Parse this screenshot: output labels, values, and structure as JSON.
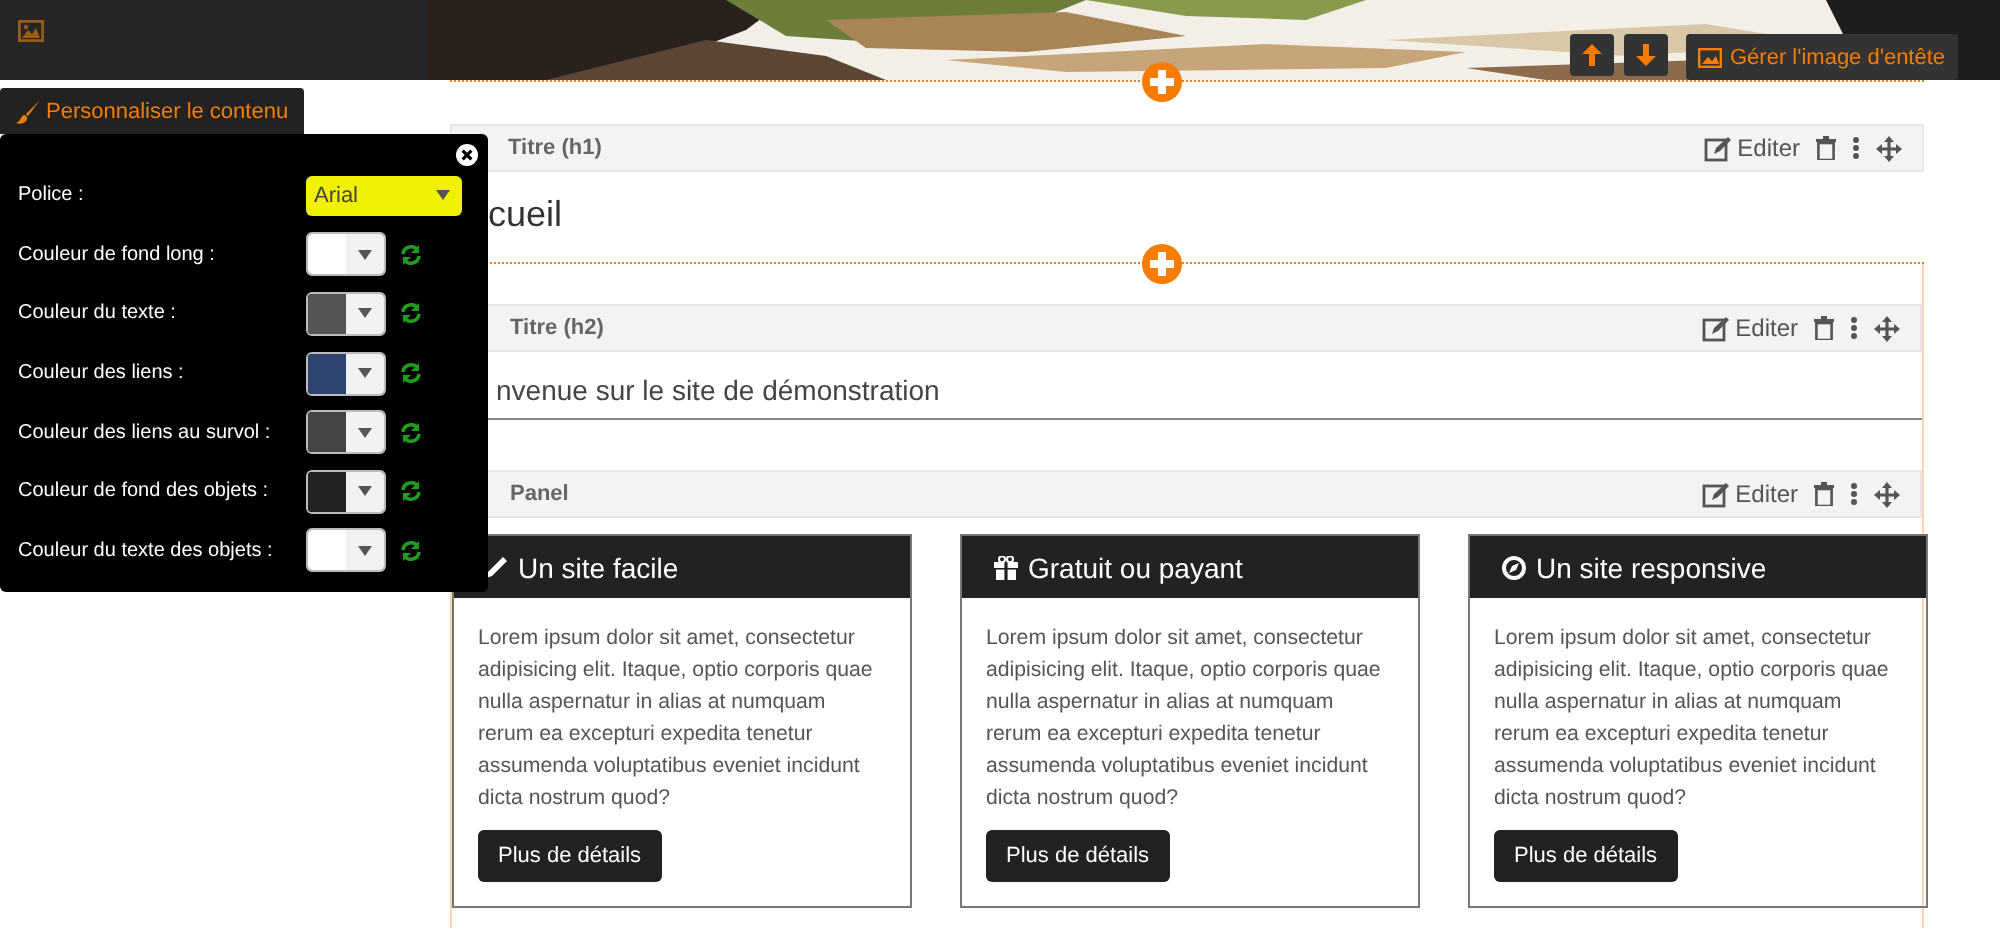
{
  "header": {
    "manage_button": "Gérer l'image d'entête"
  },
  "customize": {
    "button": "Personnaliser le contenu",
    "font": {
      "label": "Police :",
      "value": "Arial"
    },
    "colors": [
      {
        "label": "Couleur de fond long :",
        "color": "#ffffff"
      },
      {
        "label": "Couleur du texte :",
        "color": "#555555"
      },
      {
        "label": "Couleur des liens :",
        "color": "#2e4470"
      },
      {
        "label": "Couleur des liens au survol :",
        "color": "#444444"
      },
      {
        "label": "Couleur de fond des objets :",
        "color": "#222222"
      },
      {
        "label": "Couleur du texte des objets :",
        "color": "#ffffff"
      }
    ]
  },
  "blocks": [
    {
      "kind": "heading1",
      "header": "Titre (h1)",
      "edit": "Editer",
      "text": "cueil"
    },
    {
      "kind": "heading2",
      "header": "Titre (h2)",
      "edit": "Editer",
      "text": "nvenue sur le site de démonstration"
    },
    {
      "kind": "panel",
      "header": "Panel",
      "edit": "Editer",
      "cards": [
        {
          "title": "Un site facile",
          "body": "Lorem ipsum dolor sit amet, consectetur adipisicing elit. Itaque, optio corporis quae nulla aspernatur in alias at numquam rerum ea excepturi expedita tenetur assumenda voluptatibus eveniet incidunt dicta nostrum quod?",
          "button": "Plus de détails"
        },
        {
          "title": "Gratuit ou payant",
          "body": "Lorem ipsum dolor sit amet, consectetur adipisicing elit. Itaque, optio corporis quae nulla aspernatur in alias at numquam rerum ea excepturi expedita tenetur assumenda voluptatibus eveniet incidunt dicta nostrum quod?",
          "button": "Plus de détails"
        },
        {
          "title": "Un site responsive",
          "body": "Lorem ipsum dolor sit amet, consectetur adipisicing elit. Itaque, optio corporis quae nulla aspernatur in alias at numquam rerum ea excepturi expedita tenetur assumenda voluptatibus eveniet incidunt dicta nostrum quod?",
          "button": "Plus de détails"
        }
      ]
    }
  ]
}
